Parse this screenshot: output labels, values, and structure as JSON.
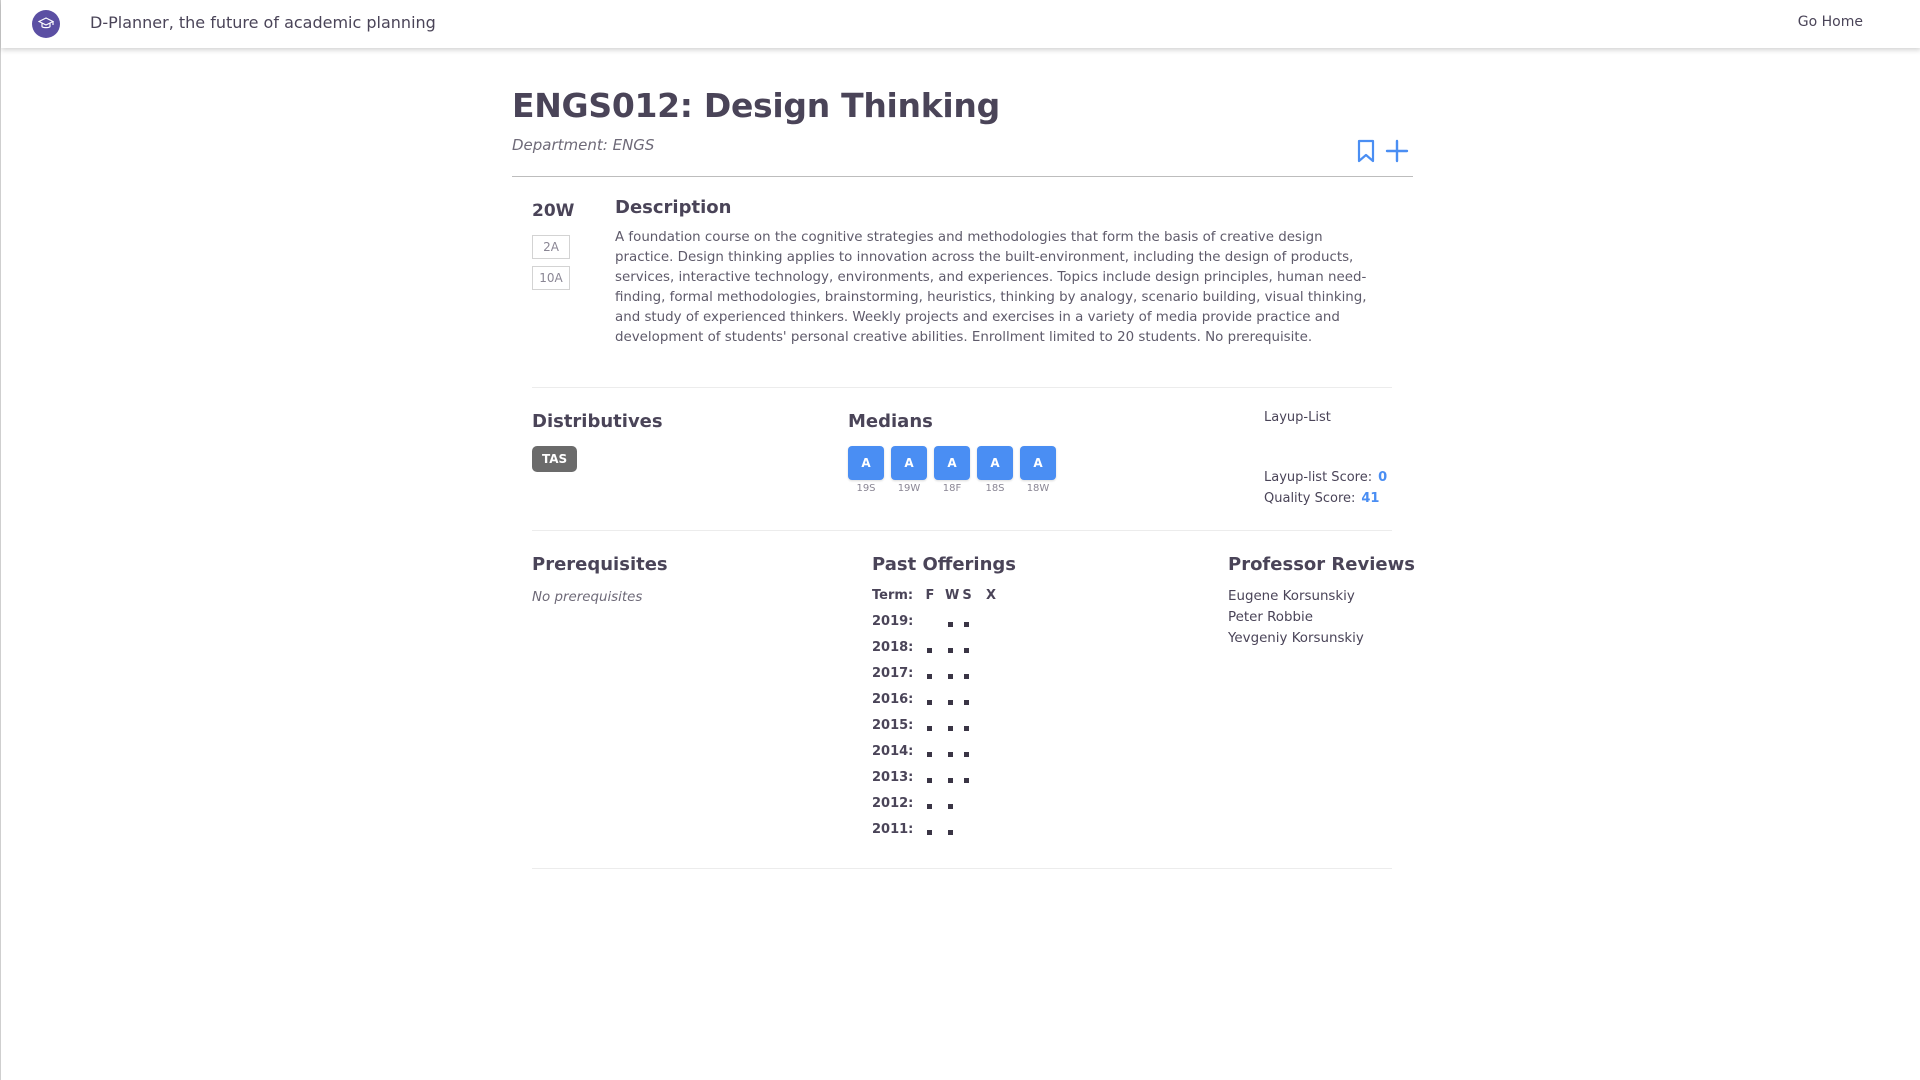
{
  "app": {
    "title": "D-Planner, the future of academic planning",
    "nav_home": "Go Home",
    "logo_icon": "graduation-cap-icon",
    "accent_color": "#4a8ef3",
    "brand_color": "#5b4fa3"
  },
  "course": {
    "title": "ENGS012: Design Thinking",
    "department_label": "Department:",
    "department_value": "ENGS",
    "term": "20W",
    "periods": [
      "2A",
      "10A"
    ],
    "description_heading": "Description",
    "description": "A foundation course on the cognitive strategies and methodologies that form the basis of creative design practice. Design thinking applies to innovation across the built-environment, including the design of products, services, interactive technology, environments, and experiences. Topics include design principles, human need-finding, formal methodologies, brainstorming, heuristics, thinking by analogy, scenario building, visual thinking, and study of experienced thinkers. Weekly projects and exercises in a variety of media provide practice and development of students' personal creative abilities. Enrollment limited to 20 students. No prerequisite."
  },
  "distributives": {
    "heading": "Distributives",
    "items": [
      "TAS"
    ]
  },
  "medians": {
    "heading": "Medians",
    "items": [
      {
        "grade": "A",
        "term": "19S"
      },
      {
        "grade": "A",
        "term": "19W"
      },
      {
        "grade": "A",
        "term": "18F"
      },
      {
        "grade": "A",
        "term": "18S"
      },
      {
        "grade": "A",
        "term": "18W"
      }
    ]
  },
  "layup": {
    "label": "Layup-List",
    "layup_score_label": "Layup-list Score:",
    "layup_score": "0",
    "quality_score_label": "Quality Score:",
    "quality_score": "41"
  },
  "prerequisites": {
    "heading": "Prerequisites",
    "empty_text": "No prerequisites"
  },
  "past_offerings": {
    "heading": "Past Offerings",
    "term_label": "Term:",
    "columns": [
      "F",
      "W",
      "S",
      "X"
    ],
    "rows": [
      {
        "year": "2019:",
        "offered": [
          false,
          true,
          true,
          false
        ]
      },
      {
        "year": "2018:",
        "offered": [
          true,
          true,
          true,
          false
        ]
      },
      {
        "year": "2017:",
        "offered": [
          true,
          true,
          true,
          false
        ]
      },
      {
        "year": "2016:",
        "offered": [
          true,
          true,
          true,
          false
        ]
      },
      {
        "year": "2015:",
        "offered": [
          true,
          true,
          true,
          false
        ]
      },
      {
        "year": "2014:",
        "offered": [
          true,
          true,
          true,
          false
        ]
      },
      {
        "year": "2013:",
        "offered": [
          true,
          true,
          true,
          false
        ]
      },
      {
        "year": "2012:",
        "offered": [
          true,
          true,
          false,
          false
        ]
      },
      {
        "year": "2011:",
        "offered": [
          true,
          true,
          false,
          false
        ]
      }
    ]
  },
  "professor_reviews": {
    "heading": "Professor Reviews",
    "names": [
      "Eugene Korsunskiy",
      "Peter Robbie",
      "Yevgeniy Korsunskiy"
    ]
  },
  "icons": {
    "bookmark": "bookmark-icon",
    "add": "plus-icon"
  }
}
